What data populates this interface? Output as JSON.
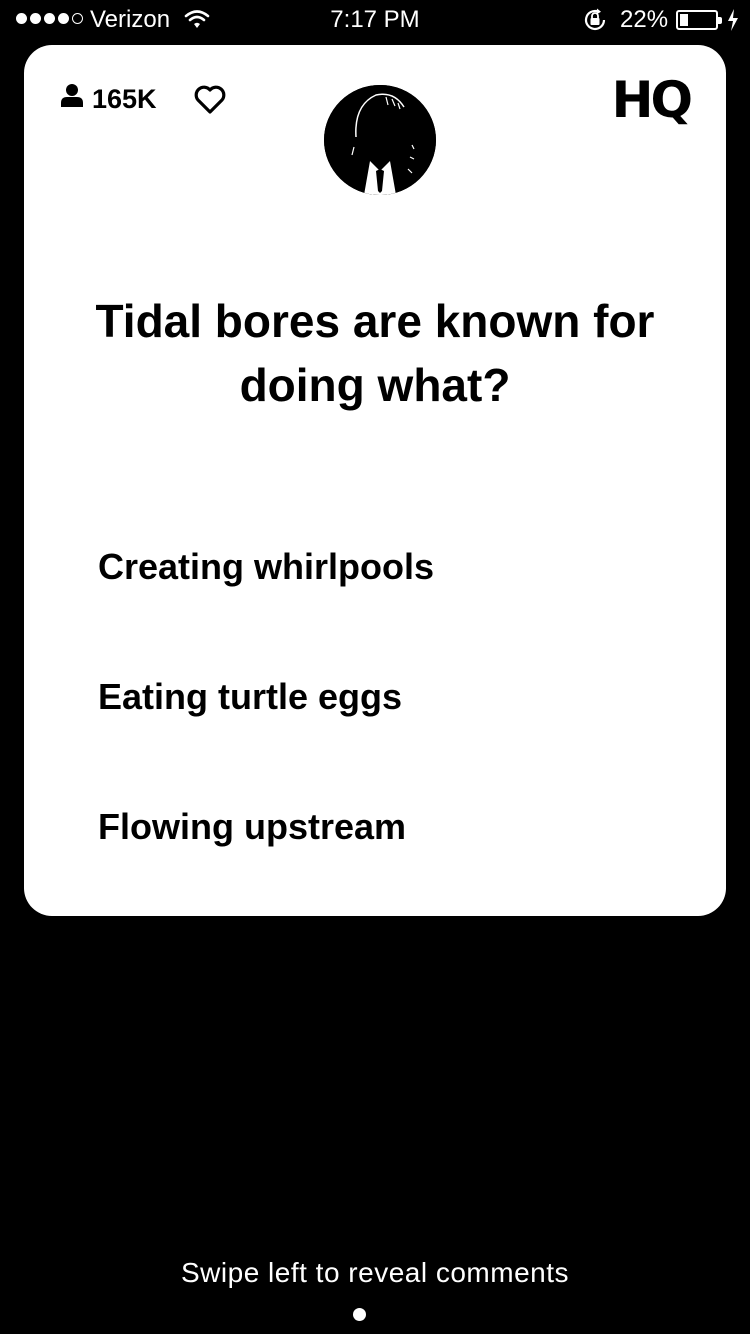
{
  "status_bar": {
    "carrier": "Verizon",
    "time": "7:17 PM",
    "battery_percent": "22%",
    "signal_bars": 4,
    "icons": [
      "wifi-icon",
      "rotation-lock-icon",
      "battery-icon",
      "charging-bolt-icon"
    ]
  },
  "card": {
    "viewer_count": "165K",
    "logo": "HQ",
    "question": "Tidal bores are known for doing what?",
    "answers": [
      {
        "label": "Creating whirlpools"
      },
      {
        "label": "Eating turtle eggs"
      },
      {
        "label": "Flowing upstream"
      }
    ]
  },
  "footer": {
    "hint": "Swipe left to reveal comments"
  },
  "colors": {
    "background": "#000000",
    "card": "#ffffff",
    "text_on_card": "#000000"
  }
}
